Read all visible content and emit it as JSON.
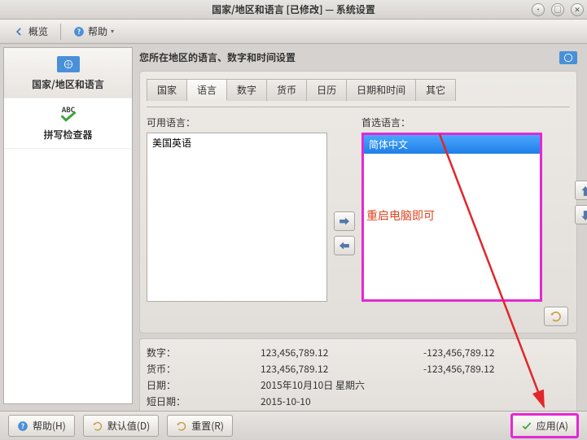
{
  "window": {
    "title": "国家/地区和语言 [已修改] — 系统设置"
  },
  "toolbar": {
    "overview": "概览",
    "help": "帮助"
  },
  "sidebar": {
    "items": [
      {
        "label": "国家/地区和语言"
      },
      {
        "label": "拼写检查器"
      }
    ]
  },
  "section": {
    "title": "您所在地区的语言、数字和时间设置"
  },
  "tabs": {
    "items": [
      {
        "label": "国家"
      },
      {
        "label": "语言"
      },
      {
        "label": "数字"
      },
      {
        "label": "货币"
      },
      {
        "label": "日历"
      },
      {
        "label": "日期和时间"
      },
      {
        "label": "其它"
      }
    ]
  },
  "lang": {
    "available_label": "可用语言：",
    "preferred_label": "首选语言：",
    "available_items": [
      "美国英语"
    ],
    "preferred_items": [
      "简体中文"
    ]
  },
  "annotation": {
    "restart_text": "重启电脑即可"
  },
  "summary": {
    "rows": [
      {
        "k": "数字：",
        "v1": "123,456,789.12",
        "v2": "-123,456,789.12"
      },
      {
        "k": "货币：",
        "v1": "123,456,789.12",
        "v2": "-123,456,789.12"
      },
      {
        "k": "日期：",
        "v1": "2015年10月10日 星期六",
        "v2": ""
      },
      {
        "k": "短日期：",
        "v1": "2015-10-10",
        "v2": ""
      }
    ]
  },
  "footer": {
    "help": "帮助(H)",
    "defaults": "默认值(D)",
    "reset": "重置(R)",
    "apply": "应用(A)"
  }
}
